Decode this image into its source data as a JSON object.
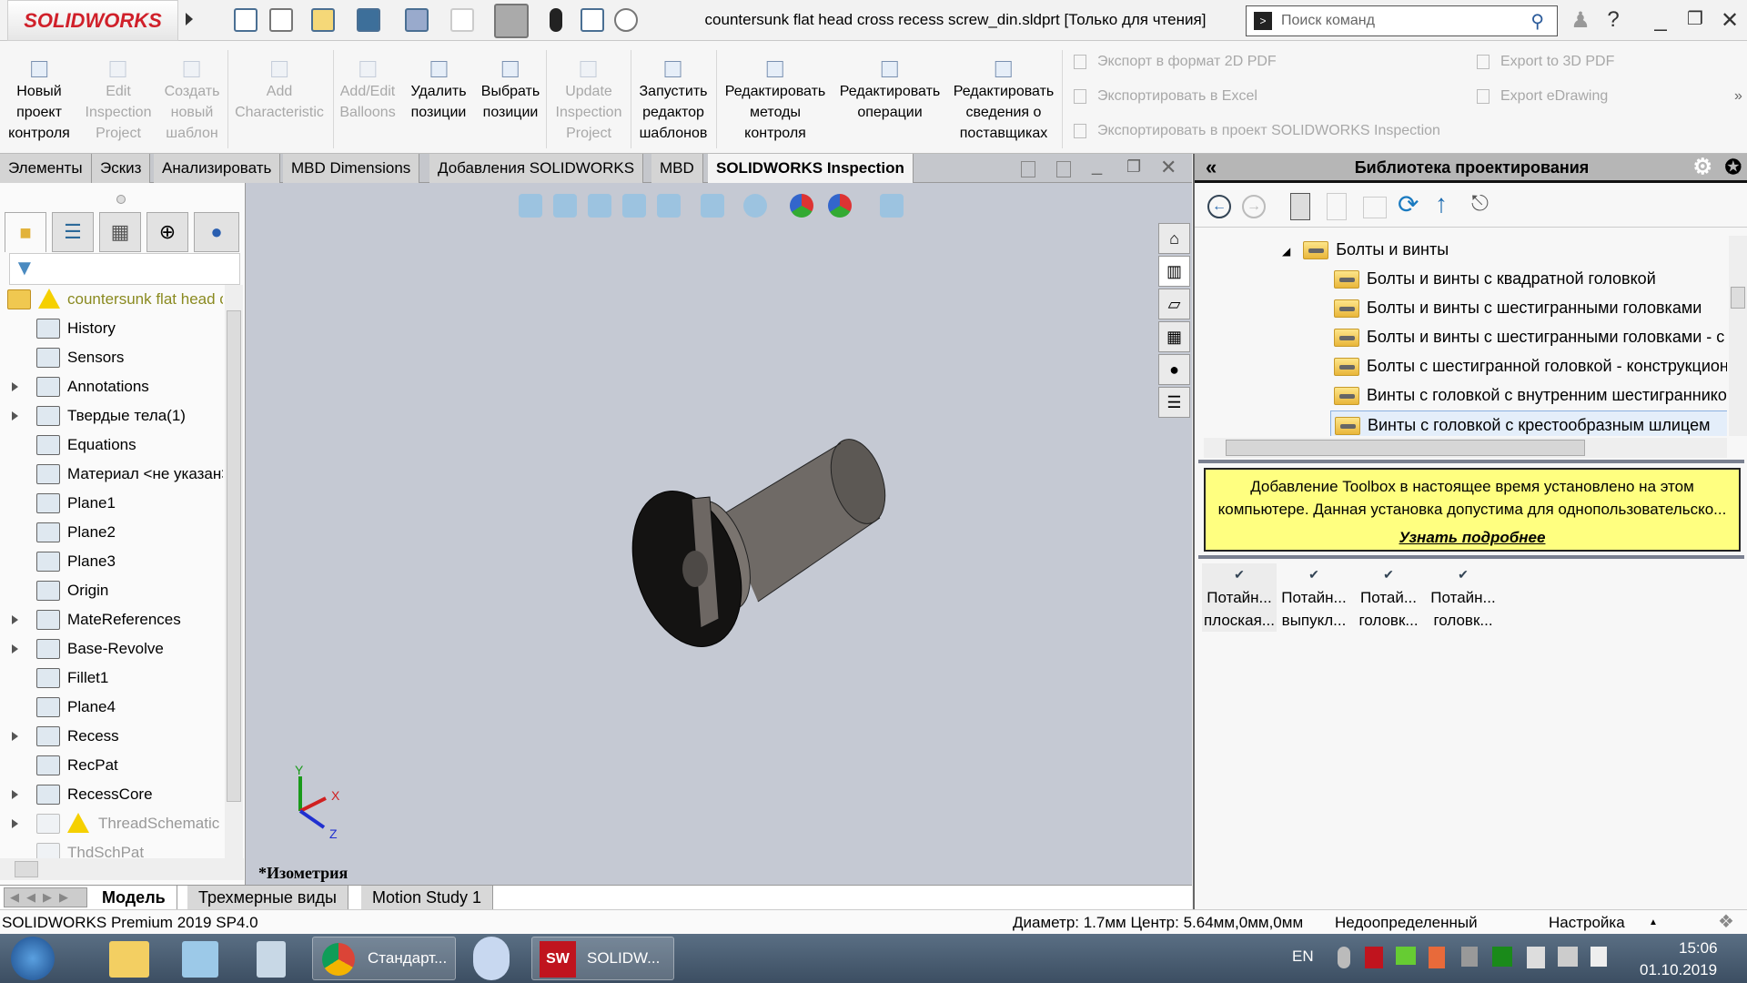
{
  "app": {
    "logo": "SOLIDWORKS",
    "title": "countersunk flat head cross recess screw_din.sldprt [Только для чтения]",
    "search_placeholder": "Поиск команд"
  },
  "ribbon": {
    "buttons": [
      {
        "label": "Новый\nпроект\nконтроля",
        "enabled": true
      },
      {
        "label": "Edit\nInspection\nProject",
        "enabled": false
      },
      {
        "label": "Создать\nновый\nшаблон",
        "enabled": false
      },
      {
        "label": "Add\nCharacteristic",
        "enabled": false
      },
      {
        "label": "Add/Edit\nBalloons",
        "enabled": false
      },
      {
        "label": "Удалить\nпозиции",
        "enabled": true
      },
      {
        "label": "Выбрать\nпозиции",
        "enabled": true
      },
      {
        "label": "Update\nInspection\nProject",
        "enabled": false
      },
      {
        "label": "Запустить\nредактор\nшаблонов",
        "enabled": true
      },
      {
        "label": "Редактировать\nметоды\nконтроля",
        "enabled": true
      },
      {
        "label": "Редактировать\nоперации",
        "enabled": true
      },
      {
        "label": "Редактировать\nсведения о\nпоставщиках",
        "enabled": true
      }
    ],
    "small": [
      "Экспорт в формат 2D PDF",
      "Экспортировать в Excel",
      "Экспортировать в проект SOLIDWORKS Inspection",
      "Export to 3D PDF",
      "Export eDrawing"
    ],
    "more": "»"
  },
  "cmd_tabs": [
    {
      "label": "Элементы"
    },
    {
      "label": "Эскиз"
    },
    {
      "label": "Анализировать"
    },
    {
      "label": "MBD Dimensions"
    },
    {
      "label": "Добавления SOLIDWORKS"
    },
    {
      "label": "MBD"
    },
    {
      "label": "SOLIDWORKS Inspection",
      "active": true
    }
  ],
  "tree": [
    {
      "label": "countersunk flat head cross recess screw_din",
      "warn": true,
      "root": true
    },
    {
      "label": "History"
    },
    {
      "label": "Sensors"
    },
    {
      "label": "Annotations",
      "expand": true
    },
    {
      "label": "Твердые тела(1)",
      "expand": true
    },
    {
      "label": "Equations"
    },
    {
      "label": "Материал <не указан>"
    },
    {
      "label": "Plane1"
    },
    {
      "label": "Plane2"
    },
    {
      "label": "Plane3"
    },
    {
      "label": "Origin"
    },
    {
      "label": "MateReferences",
      "expand": true
    },
    {
      "label": "Base-Revolve",
      "expand": true
    },
    {
      "label": "Fillet1"
    },
    {
      "label": "Plane4"
    },
    {
      "label": "Recess",
      "expand": true
    },
    {
      "label": "RecPat"
    },
    {
      "label": "RecessCore",
      "expand": true
    },
    {
      "label": "ThreadSchematic",
      "expand": true,
      "warn": true,
      "dim": true
    },
    {
      "label": "ThdSchPat",
      "dim": true
    }
  ],
  "viewport": {
    "view_name": "*Изометрия",
    "triad": {
      "x": "X",
      "y": "Y",
      "z": "Z"
    }
  },
  "bottom_tabs": [
    {
      "label": "Модель",
      "active": true
    },
    {
      "label": "Трехмерные виды"
    },
    {
      "label": "Motion Study 1"
    }
  ],
  "design_library": {
    "title": "Библиотека проектирования",
    "collapse": "«",
    "root": "Болты и винты",
    "items": [
      "Болты и винты с квадратной головкой",
      "Болты и винты с шестигранными головками",
      "Болты и винты с шестигранными головками - с мелкой резьбой",
      "Болты с шестигранной головкой - конструкционные",
      "Винты с головкой с внутренним шестигранником",
      "Винты с головкой с крестообразным шлицем"
    ],
    "selected": 5,
    "notice": "Добавление Toolbox в настоящее время установлено на этом компьютере. Данная установка допустима для однопользовательско...",
    "notice_link": "Узнать подробнее",
    "parts": [
      {
        "l1": "Потайн...",
        "l2": "плоская..."
      },
      {
        "l1": "Потайн...",
        "l2": "выпукл..."
      },
      {
        "l1": "Потай...",
        "l2": "головк..."
      },
      {
        "l1": "Потайн...",
        "l2": "головк..."
      }
    ]
  },
  "status": {
    "version": "SOLIDWORKS Premium 2019 SP4.0",
    "measure": "Диаметр: 1.7мм  Центр: 5.64мм,0мм,0мм",
    "state": "Недоопределенный",
    "settings": "Настройка"
  },
  "taskbar": {
    "apps": [
      "Стандарт...",
      "SOLIDW..."
    ],
    "lang": "EN",
    "time": "15:06",
    "date": "01.10.2019"
  }
}
